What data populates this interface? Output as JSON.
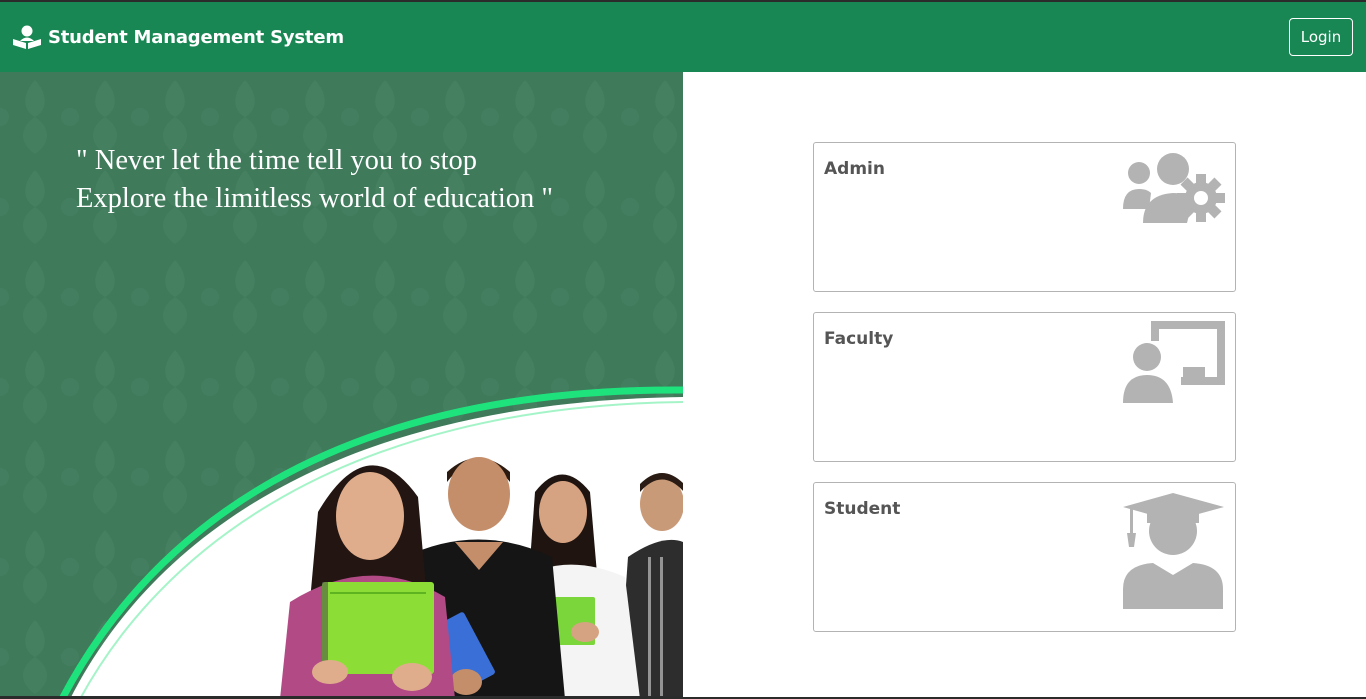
{
  "navbar": {
    "brand_icon": "reader-book-icon",
    "brand_text": "Student Management System",
    "login_label": "Login"
  },
  "hero": {
    "quote_line1": "\" Never let the time tell you to stop",
    "quote_line2": "Explore the limitless world of education \"",
    "image": "students-holding-books-photo"
  },
  "cards": [
    {
      "title": "Admin",
      "icon": "admin-users-gear-icon"
    },
    {
      "title": "Faculty",
      "icon": "faculty-presentation-board-icon"
    },
    {
      "title": "Student",
      "icon": "student-graduation-cap-icon"
    }
  ],
  "colors": {
    "navbar": "#198754",
    "hero_background": "#3f7a5b",
    "curve_accent": "#1ee37c",
    "card_icon": "#b3b3b3",
    "card_title": "#555555"
  }
}
